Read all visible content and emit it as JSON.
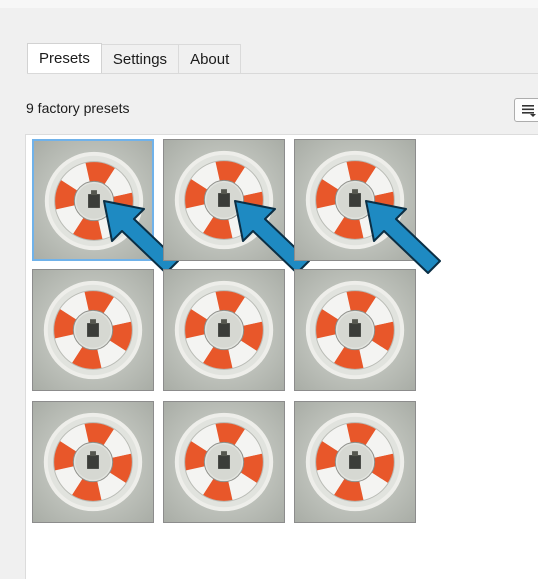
{
  "tabs": [
    {
      "label": "Presets",
      "active": true
    },
    {
      "label": "Settings",
      "active": false
    },
    {
      "label": "About",
      "active": false
    }
  ],
  "presets_header": {
    "count_label": "9 factory presets",
    "menu_icon": "list-menu-icon"
  },
  "presets": [
    {
      "name": "preset-1",
      "selected": true,
      "highlighted": true
    },
    {
      "name": "preset-2",
      "selected": false,
      "highlighted": true
    },
    {
      "name": "preset-3",
      "selected": false,
      "highlighted": true
    },
    {
      "name": "preset-4",
      "selected": false,
      "highlighted": false
    },
    {
      "name": "preset-5",
      "selected": false,
      "highlighted": false
    },
    {
      "name": "preset-6",
      "selected": false,
      "highlighted": false
    },
    {
      "name": "preset-7",
      "selected": false,
      "highlighted": false
    },
    {
      "name": "preset-8",
      "selected": false,
      "highlighted": false
    },
    {
      "name": "preset-9",
      "selected": false,
      "highlighted": false
    }
  ],
  "colors": {
    "selection_border": "#70b2ea",
    "arrow_fill": "#1e8ac2",
    "lifebuoy_orange": "#e8572a",
    "lifebuoy_white": "#f4f4f2"
  }
}
